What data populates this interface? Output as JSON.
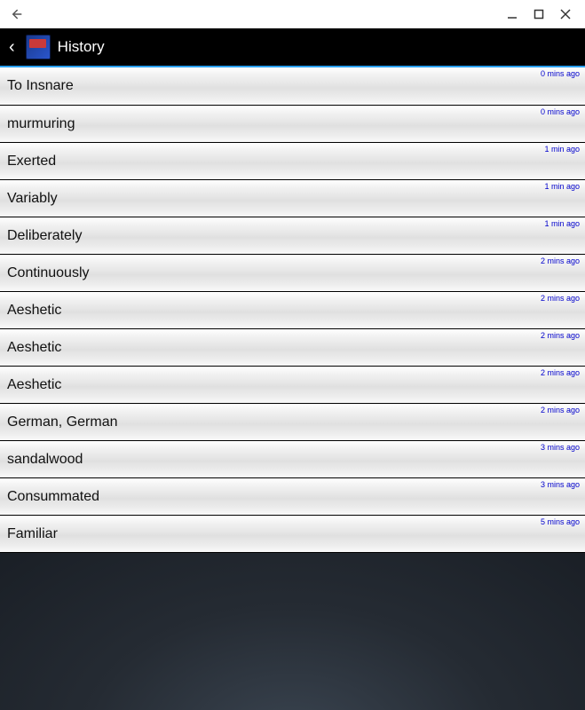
{
  "window": {
    "minimize_icon": "minimize-icon",
    "maximize_icon": "maximize-icon",
    "close_icon": "close-icon",
    "back_icon": "back-arrow-icon"
  },
  "appbar": {
    "back_glyph": "‹",
    "title": "History"
  },
  "history": [
    {
      "term": "To Insnare",
      "time": "0 mins ago"
    },
    {
      "term": "murmuring",
      "time": "0 mins ago"
    },
    {
      "term": "Exerted",
      "time": "1 min ago"
    },
    {
      "term": "Variably",
      "time": "1 min ago"
    },
    {
      "term": "Deliberately",
      "time": "1 min ago"
    },
    {
      "term": "Continuously",
      "time": "2 mins ago"
    },
    {
      "term": "Aeshetic",
      "time": "2 mins ago"
    },
    {
      "term": "Aeshetic",
      "time": "2 mins ago"
    },
    {
      "term": "Aeshetic",
      "time": "2 mins ago"
    },
    {
      "term": "German, German",
      "time": "2 mins ago"
    },
    {
      "term": "sandalwood",
      "time": "3 mins ago"
    },
    {
      "term": "Consummated",
      "time": "3 mins ago"
    },
    {
      "term": "Familiar",
      "time": "5 mins ago"
    }
  ]
}
